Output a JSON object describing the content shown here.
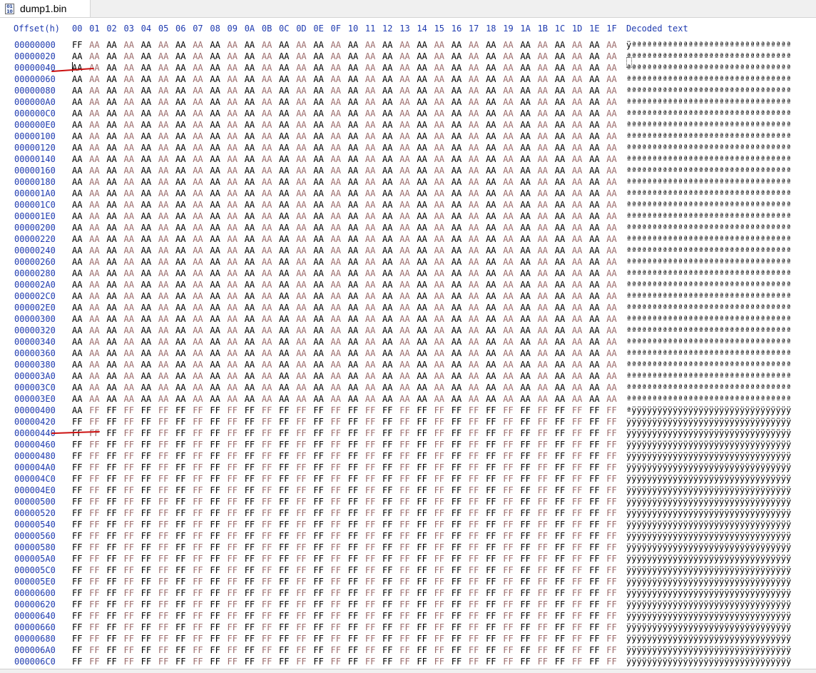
{
  "tab": {
    "title": "dump1.bin",
    "icon": "binary-file-icon",
    "icon_text": "01 10"
  },
  "header": {
    "offset_label": "Offset(h)",
    "columns": [
      "00",
      "01",
      "02",
      "03",
      "04",
      "05",
      "06",
      "07",
      "08",
      "09",
      "0A",
      "0B",
      "0C",
      "0D",
      "0E",
      "0F",
      "10",
      "11",
      "12",
      "13",
      "14",
      "15",
      "16",
      "17",
      "18",
      "19",
      "1A",
      "1B",
      "1C",
      "1D",
      "1E",
      "1F"
    ],
    "decoded_label": "Decoded text"
  },
  "rows": [
    {
      "offset": "00000000",
      "first": "FF",
      "fill": "AA",
      "text": "ÿªªªªªªªªªªªªªªªªªªªªªªªªªªªªªªª"
    },
    {
      "offset": "00000020",
      "fill": "AA",
      "text": "ªªªªªªªªªªªªªªªªªªªªªªªªªªªªªªªª"
    },
    {
      "offset": "00000040",
      "fill": "AA",
      "text": "ªªªªªªªªªªªªªªªªªªªªªªªªªªªªªªªª"
    },
    {
      "offset": "00000060",
      "fill": "AA",
      "text": "ªªªªªªªªªªªªªªªªªªªªªªªªªªªªªªªª"
    },
    {
      "offset": "00000080",
      "fill": "AA",
      "text": "ªªªªªªªªªªªªªªªªªªªªªªªªªªªªªªªª"
    },
    {
      "offset": "000000A0",
      "fill": "AA",
      "text": "ªªªªªªªªªªªªªªªªªªªªªªªªªªªªªªªª"
    },
    {
      "offset": "000000C0",
      "fill": "AA",
      "text": "ªªªªªªªªªªªªªªªªªªªªªªªªªªªªªªªª"
    },
    {
      "offset": "000000E0",
      "fill": "AA",
      "text": "ªªªªªªªªªªªªªªªªªªªªªªªªªªªªªªªª"
    },
    {
      "offset": "00000100",
      "fill": "AA",
      "text": "ªªªªªªªªªªªªªªªªªªªªªªªªªªªªªªªª"
    },
    {
      "offset": "00000120",
      "fill": "AA",
      "text": "ªªªªªªªªªªªªªªªªªªªªªªªªªªªªªªªª"
    },
    {
      "offset": "00000140",
      "fill": "AA",
      "text": "ªªªªªªªªªªªªªªªªªªªªªªªªªªªªªªªª"
    },
    {
      "offset": "00000160",
      "fill": "AA",
      "text": "ªªªªªªªªªªªªªªªªªªªªªªªªªªªªªªªª"
    },
    {
      "offset": "00000180",
      "fill": "AA",
      "text": "ªªªªªªªªªªªªªªªªªªªªªªªªªªªªªªªª"
    },
    {
      "offset": "000001A0",
      "fill": "AA",
      "text": "ªªªªªªªªªªªªªªªªªªªªªªªªªªªªªªªª"
    },
    {
      "offset": "000001C0",
      "fill": "AA",
      "text": "ªªªªªªªªªªªªªªªªªªªªªªªªªªªªªªªª"
    },
    {
      "offset": "000001E0",
      "fill": "AA",
      "text": "ªªªªªªªªªªªªªªªªªªªªªªªªªªªªªªªª"
    },
    {
      "offset": "00000200",
      "fill": "AA",
      "text": "ªªªªªªªªªªªªªªªªªªªªªªªªªªªªªªªª"
    },
    {
      "offset": "00000220",
      "fill": "AA",
      "text": "ªªªªªªªªªªªªªªªªªªªªªªªªªªªªªªªª"
    },
    {
      "offset": "00000240",
      "fill": "AA",
      "text": "ªªªªªªªªªªªªªªªªªªªªªªªªªªªªªªªª"
    },
    {
      "offset": "00000260",
      "fill": "AA",
      "text": "ªªªªªªªªªªªªªªªªªªªªªªªªªªªªªªªª"
    },
    {
      "offset": "00000280",
      "fill": "AA",
      "text": "ªªªªªªªªªªªªªªªªªªªªªªªªªªªªªªªª"
    },
    {
      "offset": "000002A0",
      "fill": "AA",
      "text": "ªªªªªªªªªªªªªªªªªªªªªªªªªªªªªªªª"
    },
    {
      "offset": "000002C0",
      "fill": "AA",
      "text": "ªªªªªªªªªªªªªªªªªªªªªªªªªªªªªªªª"
    },
    {
      "offset": "000002E0",
      "fill": "AA",
      "text": "ªªªªªªªªªªªªªªªªªªªªªªªªªªªªªªªª"
    },
    {
      "offset": "00000300",
      "fill": "AA",
      "text": "ªªªªªªªªªªªªªªªªªªªªªªªªªªªªªªªª"
    },
    {
      "offset": "00000320",
      "fill": "AA",
      "text": "ªªªªªªªªªªªªªªªªªªªªªªªªªªªªªªªª"
    },
    {
      "offset": "00000340",
      "fill": "AA",
      "text": "ªªªªªªªªªªªªªªªªªªªªªªªªªªªªªªªª"
    },
    {
      "offset": "00000360",
      "fill": "AA",
      "text": "ªªªªªªªªªªªªªªªªªªªªªªªªªªªªªªªª"
    },
    {
      "offset": "00000380",
      "fill": "AA",
      "text": "ªªªªªªªªªªªªªªªªªªªªªªªªªªªªªªªª"
    },
    {
      "offset": "000003A0",
      "fill": "AA",
      "text": "ªªªªªªªªªªªªªªªªªªªªªªªªªªªªªªªª"
    },
    {
      "offset": "000003C0",
      "fill": "AA",
      "text": "ªªªªªªªªªªªªªªªªªªªªªªªªªªªªªªªª"
    },
    {
      "offset": "000003E0",
      "fill": "AA",
      "text": "ªªªªªªªªªªªªªªªªªªªªªªªªªªªªªªªª"
    },
    {
      "offset": "00000400",
      "first": "AA",
      "fill": "FF",
      "text": "ªÿÿÿÿÿÿÿÿÿÿÿÿÿÿÿÿÿÿÿÿÿÿÿÿÿÿÿÿÿÿÿ"
    },
    {
      "offset": "00000420",
      "fill": "FF",
      "text": "ÿÿÿÿÿÿÿÿÿÿÿÿÿÿÿÿÿÿÿÿÿÿÿÿÿÿÿÿÿÿÿÿ"
    },
    {
      "offset": "00000440",
      "fill": "FF",
      "text": "ÿÿÿÿÿÿÿÿÿÿÿÿÿÿÿÿÿÿÿÿÿÿÿÿÿÿÿÿÿÿÿÿ"
    },
    {
      "offset": "00000460",
      "fill": "FF",
      "text": "ÿÿÿÿÿÿÿÿÿÿÿÿÿÿÿÿÿÿÿÿÿÿÿÿÿÿÿÿÿÿÿÿ"
    },
    {
      "offset": "00000480",
      "fill": "FF",
      "text": "ÿÿÿÿÿÿÿÿÿÿÿÿÿÿÿÿÿÿÿÿÿÿÿÿÿÿÿÿÿÿÿÿ"
    },
    {
      "offset": "000004A0",
      "fill": "FF",
      "text": "ÿÿÿÿÿÿÿÿÿÿÿÿÿÿÿÿÿÿÿÿÿÿÿÿÿÿÿÿÿÿÿÿ"
    },
    {
      "offset": "000004C0",
      "fill": "FF",
      "text": "ÿÿÿÿÿÿÿÿÿÿÿÿÿÿÿÿÿÿÿÿÿÿÿÿÿÿÿÿÿÿÿÿ"
    },
    {
      "offset": "000004E0",
      "fill": "FF",
      "text": "ÿÿÿÿÿÿÿÿÿÿÿÿÿÿÿÿÿÿÿÿÿÿÿÿÿÿÿÿÿÿÿÿ"
    },
    {
      "offset": "00000500",
      "fill": "FF",
      "text": "ÿÿÿÿÿÿÿÿÿÿÿÿÿÿÿÿÿÿÿÿÿÿÿÿÿÿÿÿÿÿÿÿ"
    },
    {
      "offset": "00000520",
      "fill": "FF",
      "text": "ÿÿÿÿÿÿÿÿÿÿÿÿÿÿÿÿÿÿÿÿÿÿÿÿÿÿÿÿÿÿÿÿ"
    },
    {
      "offset": "00000540",
      "fill": "FF",
      "text": "ÿÿÿÿÿÿÿÿÿÿÿÿÿÿÿÿÿÿÿÿÿÿÿÿÿÿÿÿÿÿÿÿ"
    },
    {
      "offset": "00000560",
      "fill": "FF",
      "text": "ÿÿÿÿÿÿÿÿÿÿÿÿÿÿÿÿÿÿÿÿÿÿÿÿÿÿÿÿÿÿÿÿ"
    },
    {
      "offset": "00000580",
      "fill": "FF",
      "text": "ÿÿÿÿÿÿÿÿÿÿÿÿÿÿÿÿÿÿÿÿÿÿÿÿÿÿÿÿÿÿÿÿ"
    },
    {
      "offset": "000005A0",
      "fill": "FF",
      "text": "ÿÿÿÿÿÿÿÿÿÿÿÿÿÿÿÿÿÿÿÿÿÿÿÿÿÿÿÿÿÿÿÿ"
    },
    {
      "offset": "000005C0",
      "fill": "FF",
      "text": "ÿÿÿÿÿÿÿÿÿÿÿÿÿÿÿÿÿÿÿÿÿÿÿÿÿÿÿÿÿÿÿÿ"
    },
    {
      "offset": "000005E0",
      "fill": "FF",
      "text": "ÿÿÿÿÿÿÿÿÿÿÿÿÿÿÿÿÿÿÿÿÿÿÿÿÿÿÿÿÿÿÿÿ"
    },
    {
      "offset": "00000600",
      "fill": "FF",
      "text": "ÿÿÿÿÿÿÿÿÿÿÿÿÿÿÿÿÿÿÿÿÿÿÿÿÿÿÿÿÿÿÿÿ"
    },
    {
      "offset": "00000620",
      "fill": "FF",
      "text": "ÿÿÿÿÿÿÿÿÿÿÿÿÿÿÿÿÿÿÿÿÿÿÿÿÿÿÿÿÿÿÿÿ"
    },
    {
      "offset": "00000640",
      "fill": "FF",
      "text": "ÿÿÿÿÿÿÿÿÿÿÿÿÿÿÿÿÿÿÿÿÿÿÿÿÿÿÿÿÿÿÿÿ"
    },
    {
      "offset": "00000660",
      "fill": "FF",
      "text": "ÿÿÿÿÿÿÿÿÿÿÿÿÿÿÿÿÿÿÿÿÿÿÿÿÿÿÿÿÿÿÿÿ"
    },
    {
      "offset": "00000680",
      "fill": "FF",
      "text": "ÿÿÿÿÿÿÿÿÿÿÿÿÿÿÿÿÿÿÿÿÿÿÿÿÿÿÿÿÿÿÿÿ"
    },
    {
      "offset": "000006A0",
      "fill": "FF",
      "text": "ÿÿÿÿÿÿÿÿÿÿÿÿÿÿÿÿÿÿÿÿÿÿÿÿÿÿÿÿÿÿÿÿ"
    },
    {
      "offset": "000006C0",
      "fill": "FF",
      "text": "ÿÿÿÿÿÿÿÿÿÿÿÿÿÿÿÿÿÿÿÿÿÿÿÿÿÿÿÿÿÿÿÿ"
    }
  ],
  "colors": {
    "offset_blue": "#1f3bb0",
    "byte_dark": "#000000",
    "byte_light": "#9b6b6b",
    "annotation_red": "#c11111"
  }
}
